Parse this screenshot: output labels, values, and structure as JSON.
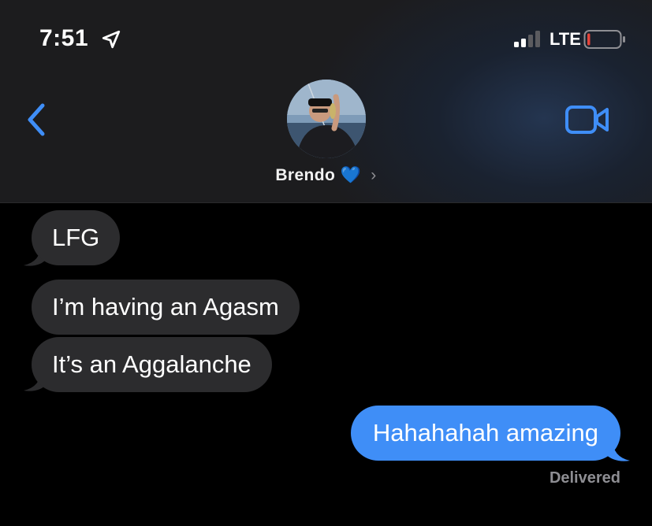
{
  "status_bar": {
    "time": "7:51",
    "network": "LTE",
    "signal_bars": 2,
    "battery_level": 0.05,
    "battery_color": "#e5443a",
    "icons": [
      "location-arrow-icon",
      "signal-icon",
      "battery-icon"
    ]
  },
  "header": {
    "contact_name": "Brendo",
    "contact_emoji": "💙",
    "chevron": "›",
    "icons": [
      "back-chevron-icon",
      "video-camera-icon"
    ],
    "accent": "#3f8ef7"
  },
  "messages": [
    {
      "direction": "received",
      "text": "LFG"
    },
    {
      "direction": "received",
      "text": "I’m having an Agasm"
    },
    {
      "direction": "received",
      "text": "It’s an Aggalanche"
    },
    {
      "direction": "sent",
      "text": "Hahahahah amazing"
    }
  ],
  "delivery_status": "Delivered",
  "colors": {
    "received_bubble": "#2c2c2e",
    "sent_bubble": "#3f8ef7",
    "background": "#000000"
  }
}
